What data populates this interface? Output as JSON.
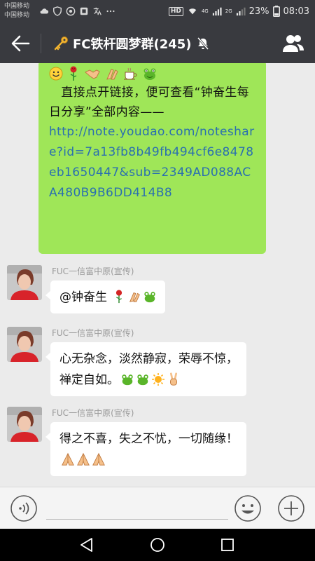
{
  "status_bar": {
    "carrier_1": "中国移动",
    "carrier_2": "中国移动",
    "hd_badge": "HD",
    "net_1": "4G",
    "net_2": "2G",
    "battery": "23%",
    "time": "08:03"
  },
  "header": {
    "title": "FC铁杆圆梦群(245)",
    "title_icon": "key-icon",
    "muted_icon": "bell-off-icon"
  },
  "messages": {
    "top_bubble": {
      "emojis": [
        "smile-icon",
        "rose-icon",
        "handshake-icon",
        "clap-icon",
        "coffee-icon",
        "frog-icon"
      ],
      "text": "　直接点开链接，便可查看“钟奋生每日分享”全部内容——",
      "link": "http://note.youdao.com/noteshare?id=7a13fb8b49fb494cf6e8478eb1650447&sub=2349AD088ACA480B9B6DD414B8"
    },
    "msg1": {
      "sender": "FUC一信富中原(宣传)",
      "text": "@钟奋生 ",
      "emojis": [
        "rose-icon",
        "clap-icon",
        "frog-icon"
      ]
    },
    "msg2": {
      "sender": "FUC一信富中原(宣传)",
      "line1": "心无杂念，淡然静寂，荣辱不惊，",
      "line2": "禅定自如。",
      "emojis": [
        "frog-icon",
        "frog-icon",
        "sun-icon",
        "victory-icon"
      ]
    },
    "msg3": {
      "sender": "FUC一信富中原(宣传)",
      "line1": "得之不喜，失之不忧，一切随缘！",
      "emojis": [
        "pray-icon",
        "pray-icon",
        "pray-icon"
      ]
    }
  },
  "input_bar": {
    "value": ""
  },
  "colors": {
    "header_bg": "#393a3f",
    "chat_bg": "#ebebeb",
    "self_bubble": "#9fe658",
    "link": "#2a6fb0"
  }
}
